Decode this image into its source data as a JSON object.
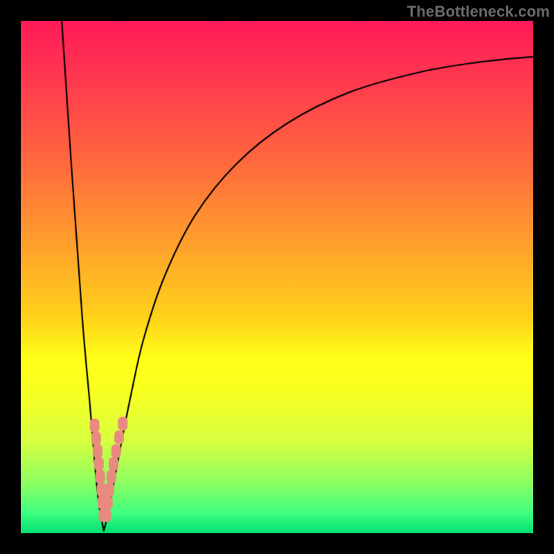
{
  "watermark": {
    "text": "TheBottleneck.com"
  },
  "colors": {
    "curve": "#000000",
    "marker": "#e88a80",
    "marker_inner": "#e88a80",
    "marker_edge": "#d57066",
    "frame": "#000000"
  },
  "chart_data": {
    "type": "line",
    "title": "",
    "xlabel": "",
    "ylabel": "",
    "xlim": [
      0,
      100
    ],
    "ylim": [
      0,
      100
    ],
    "grid": false,
    "legend": "none",
    "notes": "No axis tick labels are visible; values are estimated on a 0–100 plot-area scale.",
    "series": [
      {
        "name": "left-branch",
        "x": [
          8.0,
          10.0,
          12.0,
          13.5,
          14.5,
          15.2,
          15.8,
          16.2
        ],
        "y": [
          100.0,
          70.0,
          42.0,
          25.0,
          13.0,
          6.0,
          2.5,
          0.5
        ]
      },
      {
        "name": "right-branch",
        "x": [
          16.2,
          16.6,
          17.2,
          18.2,
          19.5,
          21.5,
          24.0,
          28.0,
          34.0,
          42.0,
          52.0,
          64.0,
          78.0,
          90.0,
          100.0
        ],
        "y": [
          0.5,
          2.0,
          5.0,
          10.0,
          17.0,
          27.0,
          38.0,
          50.0,
          62.0,
          72.0,
          80.0,
          86.0,
          90.0,
          92.0,
          93.0
        ]
      }
    ],
    "markers": {
      "name": "notch-cluster",
      "shape": "rounded",
      "points_xy": [
        [
          14.4,
          21.0
        ],
        [
          14.7,
          18.5
        ],
        [
          15.0,
          16.0
        ],
        [
          15.25,
          13.5
        ],
        [
          15.5,
          11.0
        ],
        [
          15.75,
          8.5
        ],
        [
          15.95,
          6.0
        ],
        [
          16.15,
          3.5
        ],
        [
          16.7,
          3.5
        ],
        [
          17.0,
          6.0
        ],
        [
          17.3,
          8.5
        ],
        [
          17.7,
          11.0
        ],
        [
          18.1,
          13.5
        ],
        [
          18.6,
          16.0
        ],
        [
          19.2,
          18.7
        ],
        [
          19.9,
          21.4
        ]
      ]
    }
  }
}
